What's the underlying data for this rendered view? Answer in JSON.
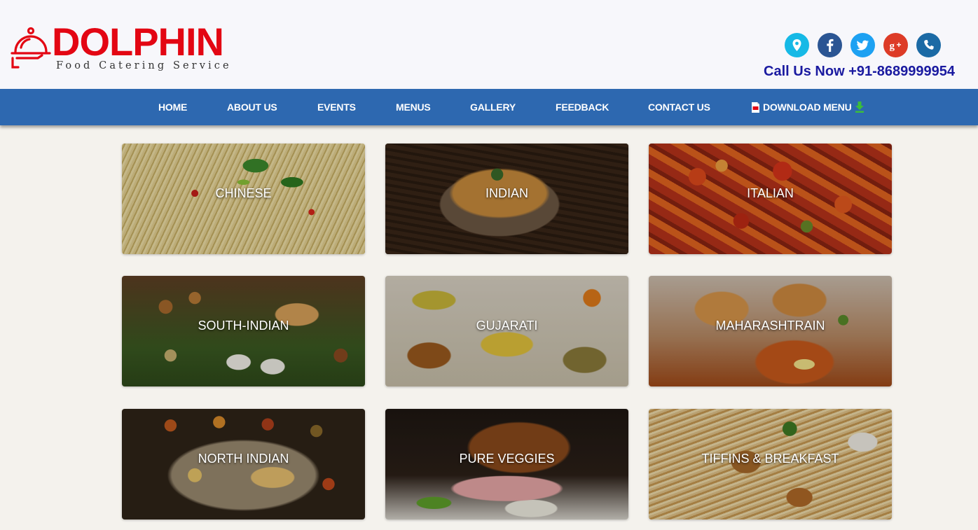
{
  "brand": {
    "name": "DOLPHIN",
    "tagline": "Food Catering Service",
    "logo_icon": "cloche-icon",
    "color": "#e30613"
  },
  "header": {
    "call_text": "Call Us Now +91-8689999954",
    "socials": [
      {
        "name": "location-icon",
        "color": "#16b9e6"
      },
      {
        "name": "facebook-icon",
        "color": "#2b5593"
      },
      {
        "name": "twitter-icon",
        "color": "#1da1f2"
      },
      {
        "name": "google-plus-icon",
        "color": "#dd3b27"
      },
      {
        "name": "phone-icon",
        "color": "#1b6aa5"
      }
    ]
  },
  "nav": {
    "color": "#2d68b0",
    "items": [
      {
        "label": "HOME"
      },
      {
        "label": "ABOUT US"
      },
      {
        "label": "EVENTS"
      },
      {
        "label": "MENUS"
      },
      {
        "label": "GALLERY"
      },
      {
        "label": "FEEDBACK"
      },
      {
        "label": "CONTACT US"
      },
      {
        "label": "DOWNLOAD MENU",
        "icons": [
          "pdf-icon",
          "download-arrow-icon"
        ]
      }
    ]
  },
  "menus": [
    {
      "label": "CHINESE"
    },
    {
      "label": "INDIAN"
    },
    {
      "label": "ITALIAN"
    },
    {
      "label": "SOUTH-INDIAN"
    },
    {
      "label": "GUJARATI"
    },
    {
      "label": "MAHARASHTRAIN"
    },
    {
      "label": "NORTH INDIAN"
    },
    {
      "label": "PURE VEGGIES"
    },
    {
      "label": "TIFFINS & BREAKFAST"
    }
  ]
}
